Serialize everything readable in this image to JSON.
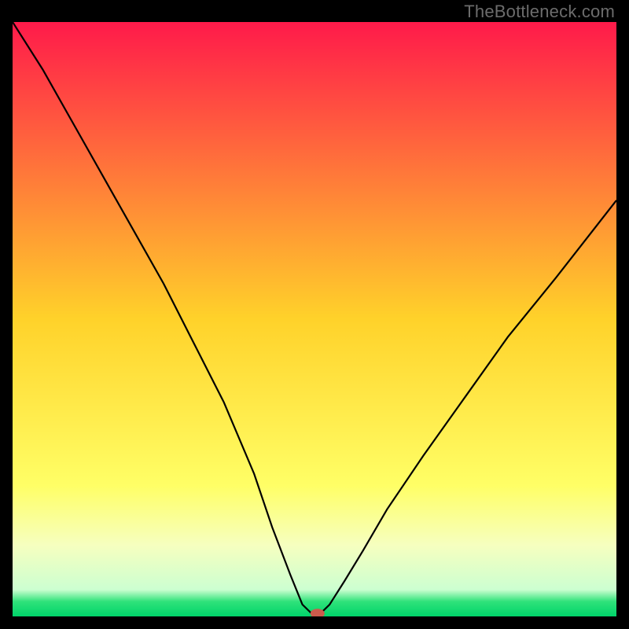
{
  "watermark": "TheBottleneck.com",
  "chart_data": {
    "type": "line",
    "title": "",
    "xlabel": "",
    "ylabel": "",
    "xlim": [
      0,
      100
    ],
    "ylim": [
      0,
      100
    ],
    "grid": false,
    "legend": false,
    "background_gradient": [
      {
        "pos": 0.0,
        "color": "#ff1a4a"
      },
      {
        "pos": 0.5,
        "color": "#ffd22a"
      },
      {
        "pos": 0.78,
        "color": "#ffff66"
      },
      {
        "pos": 0.88,
        "color": "#f6ffbf"
      },
      {
        "pos": 0.955,
        "color": "#ccffd1"
      },
      {
        "pos": 0.975,
        "color": "#2fe27a"
      },
      {
        "pos": 1.0,
        "color": "#00d46a"
      }
    ],
    "series": [
      {
        "name": "bottleneck-curve",
        "stroke": "#000000",
        "stroke_width": 2.2,
        "x": [
          0,
          5,
          10,
          15,
          20,
          25,
          30,
          35,
          40,
          43,
          46,
          48,
          49.5,
          51,
          52.5,
          55,
          58,
          62,
          68,
          75,
          82,
          90,
          100
        ],
        "y": [
          100,
          92,
          83,
          74,
          65,
          56,
          46,
          36,
          24,
          15,
          7,
          2,
          0.5,
          0.5,
          2,
          6,
          11,
          18,
          27,
          37,
          47,
          57,
          70
        ]
      }
    ],
    "marker": {
      "name": "selected-point",
      "x": 50.5,
      "y": 0.5,
      "color": "#cc5b4c",
      "rx": 9,
      "ry": 6
    }
  }
}
